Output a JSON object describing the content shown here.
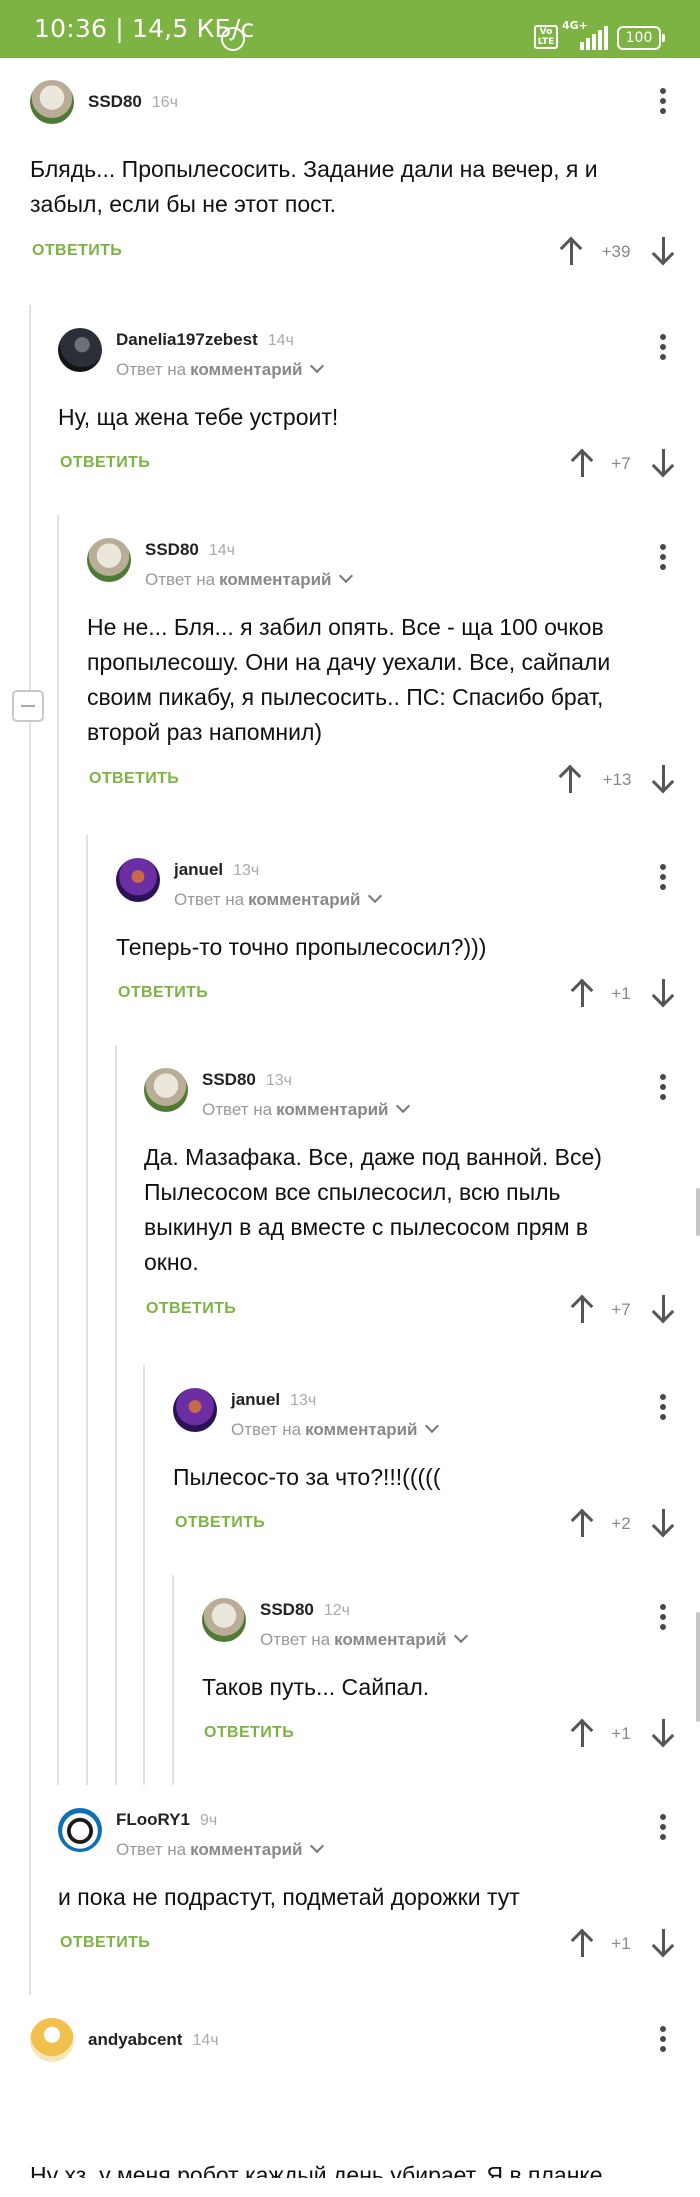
{
  "status_bar": {
    "time_speed": "10:36 | 14,5 КБ/с",
    "volte": "Vo LTE",
    "network": "4G+",
    "battery": "100"
  },
  "reply_label": "ОТВЕТИТЬ",
  "reply_to": {
    "prefix": "Ответ на",
    "target": "комментарий"
  },
  "comments": [
    {
      "user": "SSD80",
      "time": "16ч",
      "text": "Блядь... Пропылесосить. Задание дали на вечер, я и забыл, если бы не этот пост.",
      "score": "+39",
      "avatar": "hedgehog-avatar"
    },
    {
      "user": "Danelia197zebest",
      "time": "14ч",
      "text": "Ну, ща жена тебе устроит!",
      "score": "+7",
      "avatar": "dark-avatar"
    },
    {
      "user": "SSD80",
      "time": "14ч",
      "text": "Не не... Бля... я забил опять. Все - ща 100 очков пропылесошу. Они на дачу уехали. Все, сайпали своим пикабу, я пылесосить.. ПС: Спасибо брат, второй раз напомнил)",
      "score": "+13",
      "avatar": "hedgehog-avatar"
    },
    {
      "user": "januel",
      "time": "13ч",
      "text": "Теперь-то точно пропылесосил?)))",
      "score": "+1",
      "avatar": "purple-avatar"
    },
    {
      "user": "SSD80",
      "time": "13ч",
      "text": "Да. Мазафака. Все, даже под ванной. Все) Пылесосом все спылесосил, всю пыль выкинул в ад вместе с пылесосом прям в окно.",
      "score": "+7",
      "avatar": "hedgehog-avatar"
    },
    {
      "user": "januel",
      "time": "13ч",
      "text": "Пылесос-то за что?!!!(((((",
      "score": "+2",
      "avatar": "purple-avatar"
    },
    {
      "user": "SSD80",
      "time": "12ч",
      "text": "Таков путь... Сайпал.",
      "score": "+1",
      "avatar": "hedgehog-avatar"
    },
    {
      "user": "FLooRY1",
      "time": "9ч",
      "text": "и пока не подрастут, подметай дорожки тут",
      "score": "+1",
      "avatar": "panda-avatar"
    },
    {
      "user": "andyabcent",
      "time": "14ч",
      "text": "Ну хз, у меня робот каждый день убирает. Я в планке",
      "score": "",
      "avatar": "cake-avatar"
    }
  ]
}
